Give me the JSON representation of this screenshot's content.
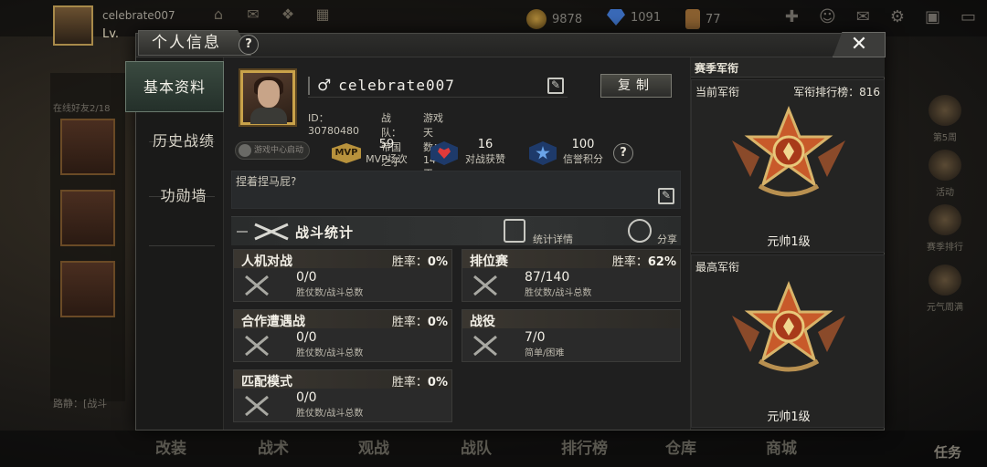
{
  "background": {
    "player_name": "celebrate007",
    "level_prefix": "Lv.",
    "top_icon_labels": [
      "",
      "",
      "礼包中心",
      "更多"
    ],
    "resources": {
      "coins": "9878",
      "gems": "1091",
      "tokens": "77"
    },
    "online_friends": "在线好友2/18",
    "chat_preview": "路静：[战斗",
    "bottom_nav": [
      "改装",
      "战术",
      "观战",
      "战队",
      "排行榜",
      "仓库",
      "商城"
    ],
    "right_side": [
      "第5周",
      "活动",
      "赛季排行",
      "元气周满"
    ],
    "task_label": "任务"
  },
  "modal": {
    "title": "个人信息",
    "help": "?",
    "close": "✕",
    "tabs": [
      "基本资料",
      "历史战绩",
      "功勋墙"
    ],
    "profile": {
      "gender_symbol": "♂",
      "name": "celebrate007",
      "copy_label": "复制",
      "id_text": "ID：30780480",
      "team_text": "战队：帝国之子",
      "days_text": "游戏天数：14天",
      "game_center": "游戏中心启动",
      "mvp_badge": "MVP",
      "mvp_value": "59",
      "mvp_label": "MVP场次",
      "likes_value": "16",
      "likes_label": "对战获赞",
      "credit_value": "100",
      "credit_label": "信誉积分",
      "stats_help": "?"
    },
    "motto": "捏着捏马屁?",
    "battle": {
      "title": "战斗统计",
      "detail": "统计详情",
      "share": "分享",
      "modes": [
        {
          "name": "人机对战",
          "rate_label": "胜率：",
          "rate": "0%",
          "value": "0/0",
          "sub": "胜仗数/战斗总数"
        },
        {
          "name": "排位赛",
          "rate_label": "胜率：",
          "rate": "62%",
          "value": "87/140",
          "sub": "胜仗数/战斗总数"
        },
        {
          "name": "合作遭遇战",
          "rate_label": "胜率：",
          "rate": "0%",
          "value": "0/0",
          "sub": "胜仗数/战斗总数"
        },
        {
          "name": "战役",
          "rate_label": "",
          "rate": "",
          "value": "7/0",
          "sub": "简单/困难"
        },
        {
          "name": "匹配模式",
          "rate_label": "胜率：",
          "rate": "0%",
          "value": "0/0",
          "sub": "胜仗数/战斗总数"
        }
      ]
    },
    "rank": {
      "title": "赛季军衔",
      "current_label": "当前军衔",
      "rank_list": "军衔排行榜：816",
      "current_level": "元帅1级",
      "highest_label": "最高军衔",
      "highest_level": "元帅1级"
    }
  }
}
